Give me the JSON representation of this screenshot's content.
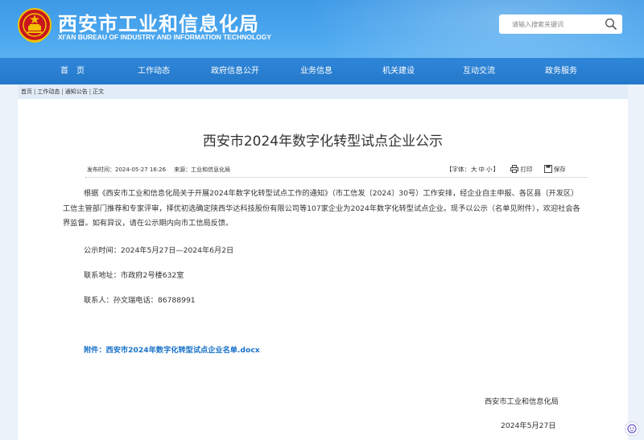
{
  "header": {
    "title_cn": "西安市工业和信息化局",
    "title_en": "XI'AN BUREAU OF INDUSTRY AND INFORMATION TECHNOLOGY",
    "search_placeholder": "请输入搜索关键词"
  },
  "nav": {
    "items": [
      "首　页",
      "工作动态",
      "政府信息公开",
      "业务信息",
      "机关建设",
      "互动交流",
      "政务服务"
    ]
  },
  "breadcrumb": {
    "items": [
      "首页",
      "工作动态",
      "通知公告",
      "正文"
    ],
    "separator": "|"
  },
  "article": {
    "title": "西安市2024年数字化转型试点企业公示",
    "publish_label": "发布时间：",
    "publish_time": "2024-05-27 16:26",
    "source_label": "来源：",
    "source": "工业和信息化局",
    "font_size_label": "【字体：",
    "font_sizes": [
      "大",
      "中",
      "小"
    ],
    "font_size_close": "】",
    "print_label": "打印",
    "save_label": "保存",
    "body": "根据《西安市工业和信息化局关于开展2024年数字化转型试点工作的通知》（市工信发〔2024〕30号）工作安排，经企业自主申报、各区县（开发区）工信主管部门推荐和专家评审，择优初选确定陕西华达科技股份有限公司等107家企业为2024年数字化转型试点企业。现予以公示（名单见附件），欢迎社会各界监督。如有异议，请在公示期内向市工信局反馈。",
    "period": "公示时间：2024年5月27日—2024年6月2日",
    "address": "联系地址：市政府2号楼632室",
    "contact": "联系人：孙文瑞电话：86788991",
    "attachment": "附件：西安市2024年数字化转型试点企业名单.docx",
    "signature_org": "西安市工业和信息化局",
    "signature_date": "2024年5月27日"
  },
  "colors": {
    "header_blue": "#4aa6ee",
    "nav_blue": "#2478c9",
    "link_blue": "#1a73c9",
    "emblem_red": "#c8161d",
    "emblem_gold": "#f2c200"
  }
}
